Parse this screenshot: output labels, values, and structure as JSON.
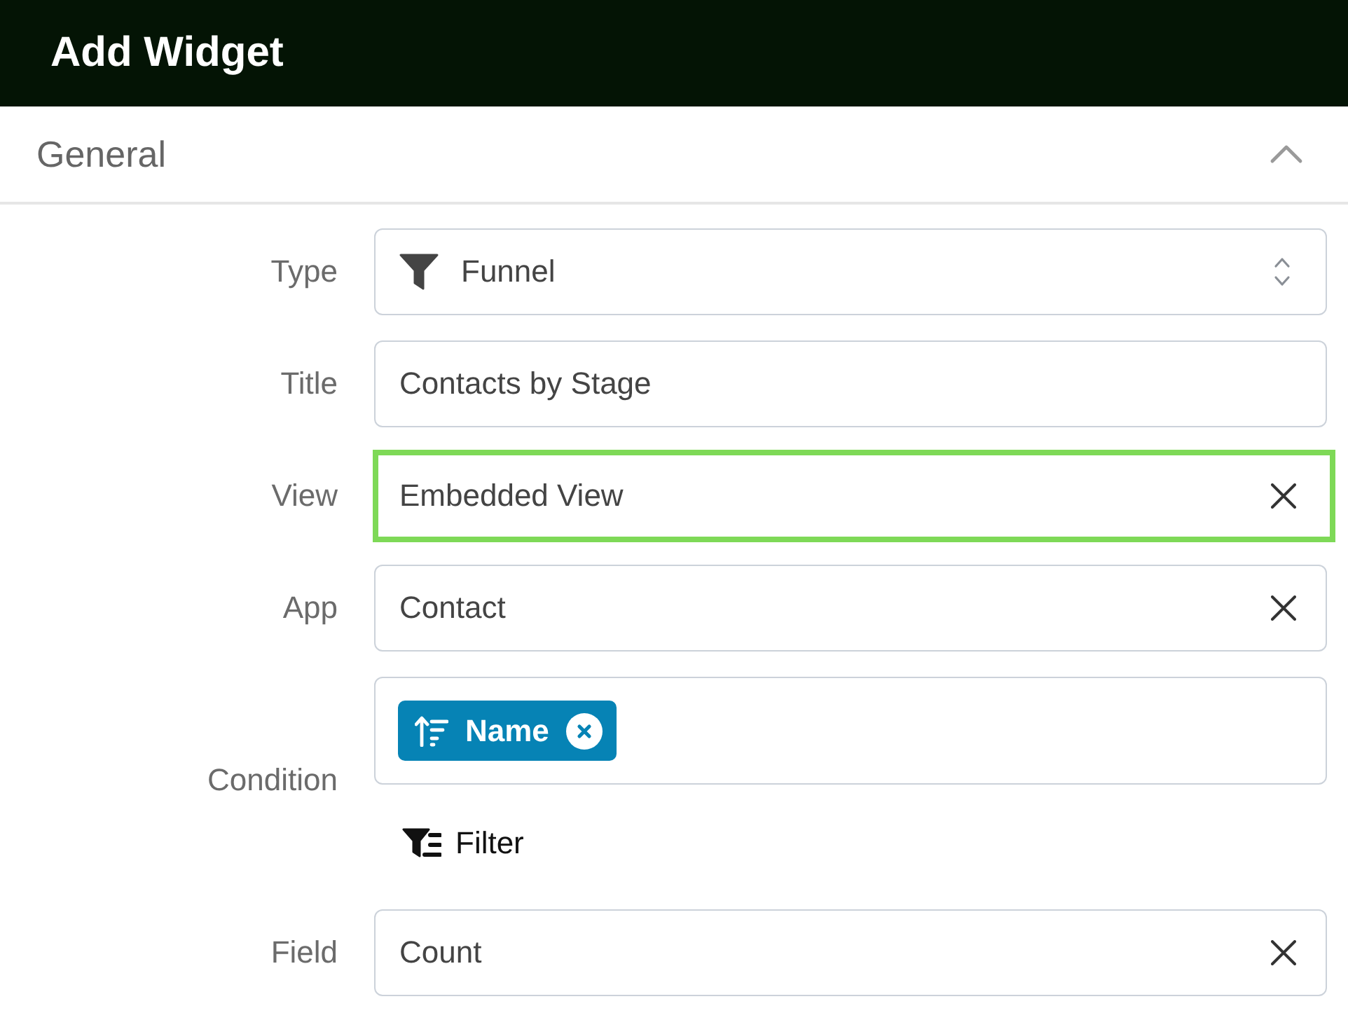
{
  "header": {
    "title": "Add Widget"
  },
  "section": {
    "title": "General",
    "expanded": true
  },
  "fields": [
    {
      "label": "Type",
      "kind": "select",
      "value": "Funnel",
      "highlighted": false
    },
    {
      "label": "Title",
      "kind": "text",
      "value": "Contacts by Stage",
      "highlighted": false
    },
    {
      "label": "View",
      "kind": "clearable",
      "value": "Embedded View",
      "highlighted": true
    },
    {
      "label": "App",
      "kind": "clearable",
      "value": "Contact",
      "highlighted": false
    },
    {
      "label": "Condition",
      "kind": "tags",
      "tags": [
        {
          "label": "Name"
        }
      ],
      "action": "Filter",
      "highlighted": false
    },
    {
      "label": "Field",
      "kind": "clearable",
      "value": "Count",
      "highlighted": false
    }
  ]
}
